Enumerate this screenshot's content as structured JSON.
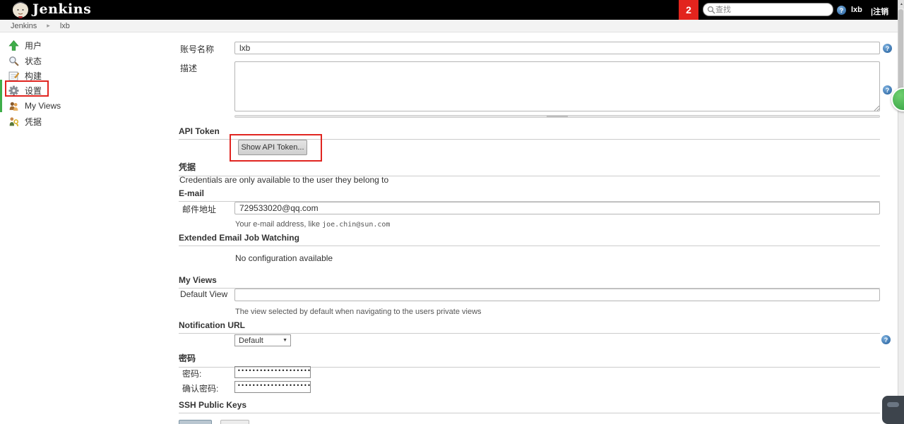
{
  "header": {
    "app_title": "Jenkins",
    "badge_count": "2",
    "search_placeholder": "查找",
    "username": "lxb",
    "logout_label": "|注销"
  },
  "breadcrumb": {
    "root": "Jenkins",
    "separator": "▸",
    "current": "lxb"
  },
  "sidebar": {
    "items": [
      {
        "icon": "arrow-up-icon",
        "label": "用户"
      },
      {
        "icon": "search-icon",
        "label": "状态"
      },
      {
        "icon": "build-history-icon",
        "label": "构建"
      },
      {
        "icon": "gear-icon",
        "label": "设置",
        "highlighted": true
      },
      {
        "icon": "people-icon",
        "label": "My Views"
      },
      {
        "icon": "credentials-icon",
        "label": "凭据"
      }
    ]
  },
  "form": {
    "fullname": {
      "label": "账号名称",
      "value": "lxb"
    },
    "description": {
      "label": "描述",
      "value": ""
    },
    "api_token": {
      "heading": "API Token",
      "button_label": "Show API Token..."
    },
    "credentials": {
      "heading": "凭据",
      "note": "Credentials are only available to the user they belong to"
    },
    "email": {
      "heading": "E-mail",
      "label": "邮件地址",
      "value": "729533020@qq.com",
      "help_prefix": "Your e-mail address, like ",
      "help_example": "joe.chin@sun.com"
    },
    "extended_email": {
      "heading": "Extended Email Job Watching",
      "note": "No configuration available"
    },
    "my_views": {
      "heading": "My Views",
      "label": "Default View",
      "value": "",
      "help": "The view selected by default when navigating to the users private views"
    },
    "notification_url": {
      "heading": "Notification URL",
      "selected": "Default",
      "arrow": "▼"
    },
    "password": {
      "heading": "密码",
      "password_label": "密码:",
      "confirm_label": "确认密码:",
      "masked_value": "••••••••••••••••••••••••••••••••••"
    },
    "ssh": {
      "heading": "SSH Public Keys"
    }
  },
  "icons": {
    "floating_right": "green-circle-widget",
    "bottom_right": "screen-tool-widget",
    "left_edge": "green-edge-tab",
    "scrollbar_arrow": "▲"
  },
  "colors": {
    "annotation_red": "#e02520",
    "accent_green": "#3fae49",
    "help_blue": "#2f6fb2",
    "header_black": "#000000"
  }
}
